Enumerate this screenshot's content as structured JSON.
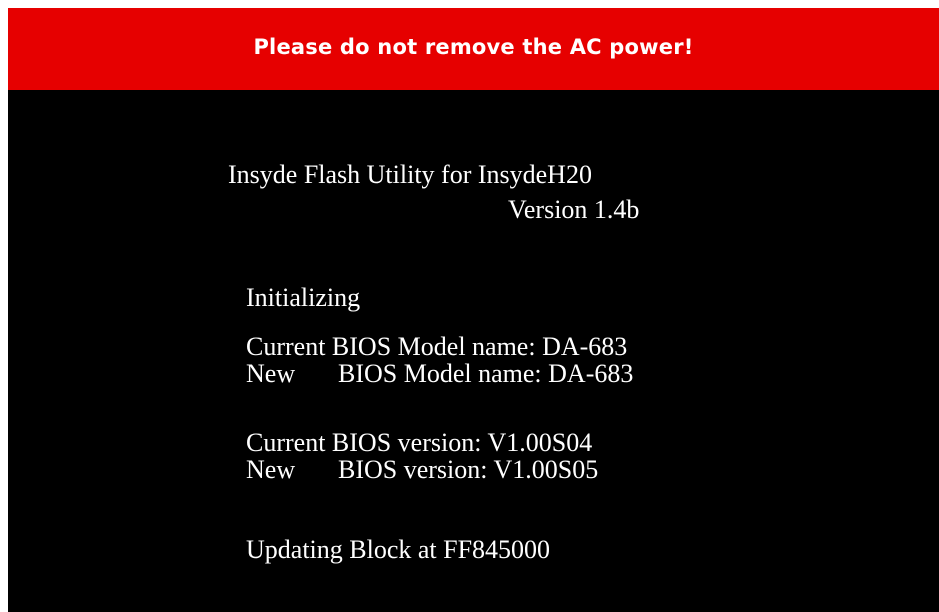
{
  "warning_banner": {
    "text": "Please do not remove the AC power!",
    "background_color": "#e60000"
  },
  "utility": {
    "title": "Insyde Flash Utility for InsydeH20",
    "version": "Version 1.4b"
  },
  "status": {
    "initializing": "Initializing",
    "current_model_label": "Current BIOS Model name: DA-683",
    "new_model_prefix": "New",
    "new_model_label": "BIOS Model name: DA-683",
    "current_version_label": "Current BIOS version: V1.00S04",
    "new_version_prefix": "New",
    "new_version_label": "BIOS version: V1.00S05",
    "updating": "Updating Block at FF845000"
  }
}
